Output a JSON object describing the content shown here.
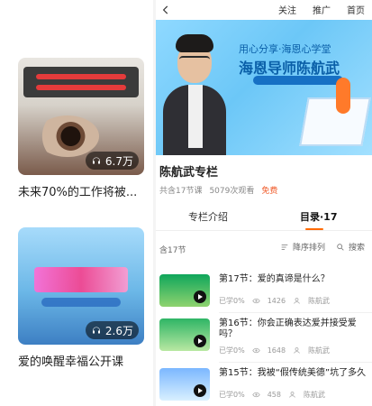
{
  "left": {
    "cards": [
      {
        "title": "未来70%的工作将被...",
        "plays": "6.7万"
      },
      {
        "title": "爱的唤醒幸福公开课",
        "plays": "2.6万"
      }
    ]
  },
  "right": {
    "topbar": {
      "follow": "关注",
      "recommend": "推广",
      "home": "首页"
    },
    "hero": {
      "line1": "用心分享·海恩心学堂",
      "line2": "海恩导师陈航武"
    },
    "info": {
      "title": "陈航武专栏",
      "episodes": "共含17节课",
      "views": "5079次观看",
      "price": "免费"
    },
    "tabs": {
      "intro": "专栏介绍",
      "directory": "目录·17"
    },
    "list": {
      "count": "含17节",
      "sort_label": "降序排列",
      "search_label": "搜索",
      "items": [
        {
          "title": "第17节：爱的真谛是什么？",
          "progress": "已学0%",
          "views": "1426",
          "author": "陈航武"
        },
        {
          "title": "第16节：你会正确表达爱并接受爱吗？",
          "progress": "已学0%",
          "views": "1648",
          "author": "陈航武"
        },
        {
          "title": "第15节：我被“假传统美德”坑了多久",
          "progress": "已学0%",
          "views": "458",
          "author": "陈航武"
        }
      ]
    }
  }
}
